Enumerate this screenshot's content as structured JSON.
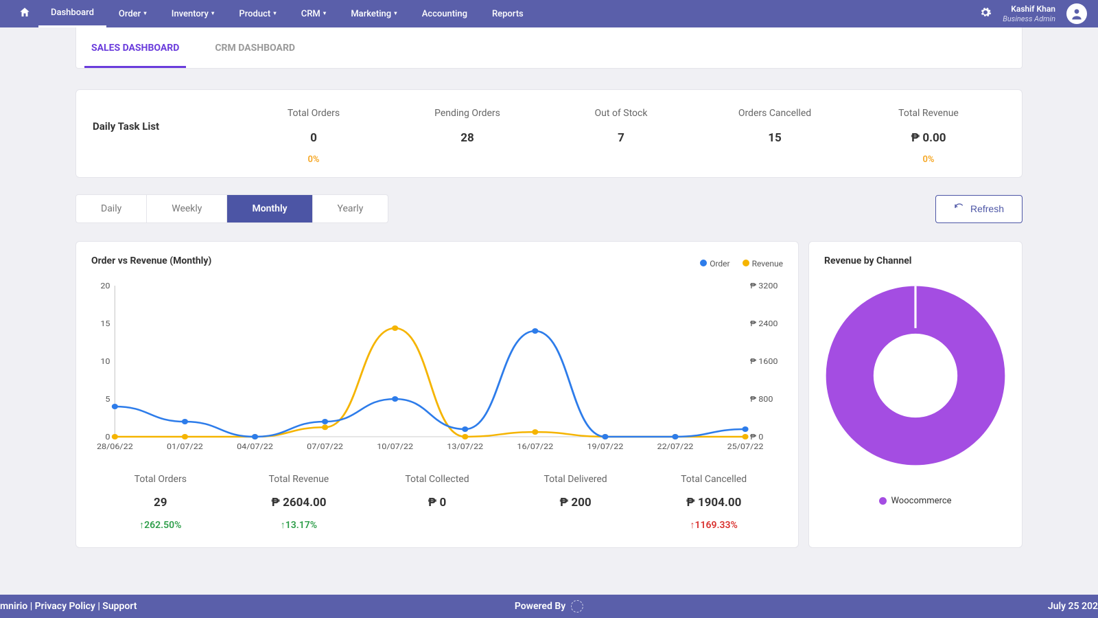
{
  "topnav": {
    "items": [
      {
        "label": "Dashboard",
        "caret": false,
        "active": true
      },
      {
        "label": "Order",
        "caret": true
      },
      {
        "label": "Inventory",
        "caret": true
      },
      {
        "label": "Product",
        "caret": true
      },
      {
        "label": "CRM",
        "caret": true
      },
      {
        "label": "Marketing",
        "caret": true
      },
      {
        "label": "Accounting",
        "caret": false
      },
      {
        "label": "Reports",
        "caret": false
      }
    ],
    "user": {
      "name": "Kashif Khan",
      "role": "Business Admin"
    }
  },
  "tabs": [
    {
      "label": "SALES DASHBOARD",
      "active": true
    },
    {
      "label": "CRM DASHBOARD",
      "active": false
    }
  ],
  "daily_task": {
    "title": "Daily Task List",
    "metrics": [
      {
        "label": "Total Orders",
        "value": "0",
        "sub": "0%"
      },
      {
        "label": "Pending Orders",
        "value": "28",
        "sub": ""
      },
      {
        "label": "Out of Stock",
        "value": "7",
        "sub": ""
      },
      {
        "label": "Orders Cancelled",
        "value": "15",
        "sub": ""
      },
      {
        "label": "Total Revenue",
        "value": "₱  0.00",
        "sub": "0%"
      }
    ]
  },
  "period_tabs": [
    "Daily",
    "Weekly",
    "Monthly",
    "Yearly"
  ],
  "period_active": "Monthly",
  "refresh_label": "Refresh",
  "chart_left": {
    "title": "Order vs Revenue (Monthly)",
    "legend": [
      "Order",
      "Revenue"
    ]
  },
  "summary": [
    {
      "label": "Total Orders",
      "value": "29",
      "change": "262.50%",
      "dir": "up",
      "cls": "green"
    },
    {
      "label": "Total Revenue",
      "value": "₱   2604.00",
      "change": "13.17%",
      "dir": "up",
      "cls": "green"
    },
    {
      "label": "Total Collected",
      "value": "₱   0",
      "change": "",
      "dir": "",
      "cls": ""
    },
    {
      "label": "Total Delivered",
      "value": "₱   200",
      "change": "",
      "dir": "",
      "cls": ""
    },
    {
      "label": "Total Cancelled",
      "value": "₱   1904.00",
      "change": "1169.33%",
      "dir": "up",
      "cls": "red"
    }
  ],
  "chart_right": {
    "title": "Revenue by Channel",
    "legend": "Woocommerce"
  },
  "footer": {
    "left": "mnirio | Privacy Policy | Support",
    "center": "Powered By",
    "right": "July 25 202"
  },
  "colors": {
    "order": "#2d7cea",
    "revenue": "#f5b400",
    "donut": "#a44de2",
    "nav": "#5a5faa",
    "accent": "#6a3cdc"
  },
  "chart_data": [
    {
      "type": "line",
      "title": "Order vs Revenue (Monthly)",
      "categories": [
        "28/06/22",
        "01/07/22",
        "04/07/22",
        "07/07/22",
        "10/07/22",
        "13/07/22",
        "16/07/22",
        "19/07/22",
        "22/07/22",
        "25/07/22"
      ],
      "series": [
        {
          "name": "Order",
          "axis": "left",
          "values": [
            4,
            2,
            0,
            2,
            5,
            1,
            14,
            0,
            0,
            1
          ]
        },
        {
          "name": "Revenue",
          "axis": "right",
          "values": [
            0,
            0,
            0,
            200,
            2300,
            0,
            100,
            0,
            0,
            0
          ]
        }
      ],
      "ylabel_left": "",
      "ylim_left": [
        0,
        20
      ],
      "yticks_left": [
        0,
        5,
        10,
        15,
        20
      ],
      "ylabel_right": "",
      "ylim_right": [
        0,
        3200
      ],
      "yticks_right": [
        0,
        800,
        1600,
        2400,
        3200
      ],
      "y_right_prefix": "₱ "
    },
    {
      "type": "pie",
      "subtype": "donut",
      "title": "Revenue by Channel",
      "series": [
        {
          "name": "Woocommerce",
          "value": 100,
          "color": "#a44de2"
        }
      ]
    }
  ]
}
